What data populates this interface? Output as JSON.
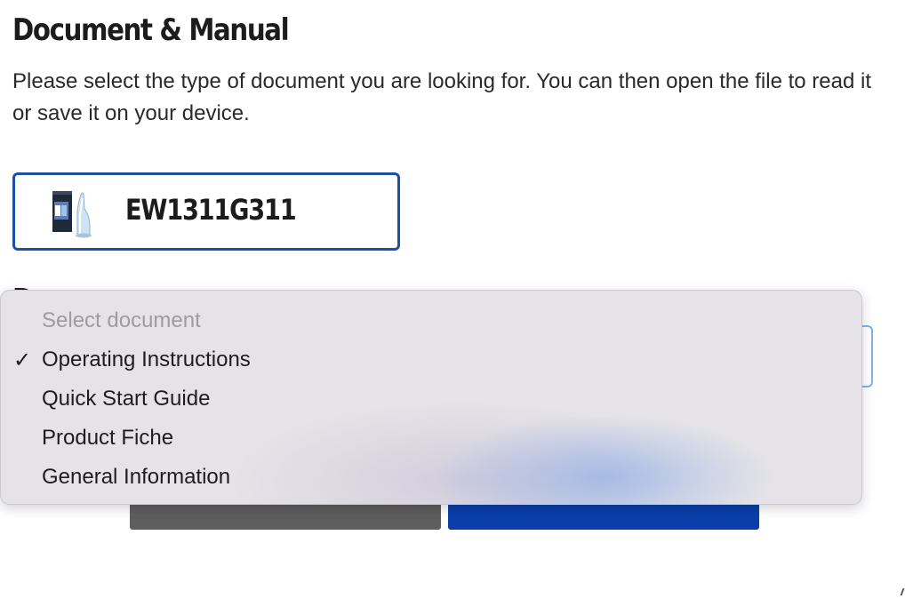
{
  "header": {
    "title": "Document & Manual",
    "intro": "Please select the type of document you are looking for. You can then open the file to read it or save it on your device."
  },
  "product": {
    "name": "EW1311G311",
    "image_icon": "product-image"
  },
  "document_select": {
    "options": [
      {
        "label": "Select document",
        "placeholder": true,
        "selected": false
      },
      {
        "label": "Operating Instructions",
        "placeholder": false,
        "selected": true
      },
      {
        "label": "Quick Start Guide",
        "placeholder": false,
        "selected": false
      },
      {
        "label": "Product Fiche",
        "placeholder": false,
        "selected": false
      },
      {
        "label": "General Information",
        "placeholder": false,
        "selected": false
      }
    ],
    "check_glyph": "✓"
  },
  "colors": {
    "accent": "#1d4fa8",
    "primary_button": "#0a3fab",
    "secondary_button": "#5e5e5e",
    "select_focus": "#7fb2ec"
  }
}
